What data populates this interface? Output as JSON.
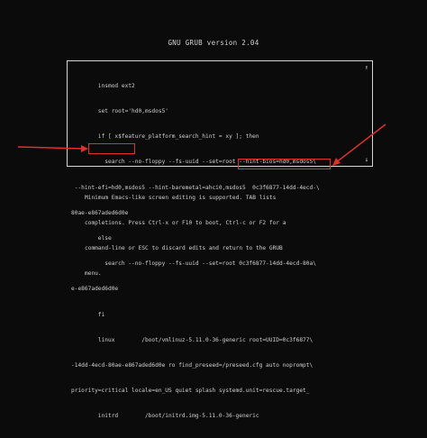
{
  "header": {
    "title": "GNU GRUB  version 2.04"
  },
  "editor": {
    "lines": [
      "        insmod ext2",
      "        set root='hd0,msdos5'",
      "        if [ x$feature_platform_search_hint = xy ]; then",
      "          search --no-floppy --fs-uuid --set=root --hint-bios=hd0,msdos5\\",
      " --hint-efi=hd0,msdos5 --hint-baremetal=ahci0,msdos5  0c3f6877-14dd-4ecd-\\",
      "80ae-e867aded6d0e",
      "        else",
      "          search --no-floppy --fs-uuid --set=root 0c3f6877-14dd-4ecd-80a\\",
      "e-e867aded6d0e",
      "        fi",
      "        linux        /boot/vmlinuz-5.11.0-36-generic root=UUID=0c3f6877\\",
      "-14dd-4ecd-80ae-e867aded6d0e ro find_preseed=/preseed.cfg auto noprompt\\",
      "priority=critical locale=en_US quiet splash systemd.unit=rescue.target_",
      "        initrd        /boot/initrd.img-5.11.0-36-generic"
    ],
    "scroll_up": "↑",
    "scroll_down": "↓"
  },
  "help": {
    "lines": [
      "Minimum Emacs-like screen editing is supported. TAB lists",
      "completions. Press Ctrl-x or F10 to boot, Ctrl-c or F2 for a",
      "command-line or ESC to discard edits and return to the GRUB",
      "menu."
    ]
  },
  "annotations": {
    "color": "#e0302a"
  }
}
